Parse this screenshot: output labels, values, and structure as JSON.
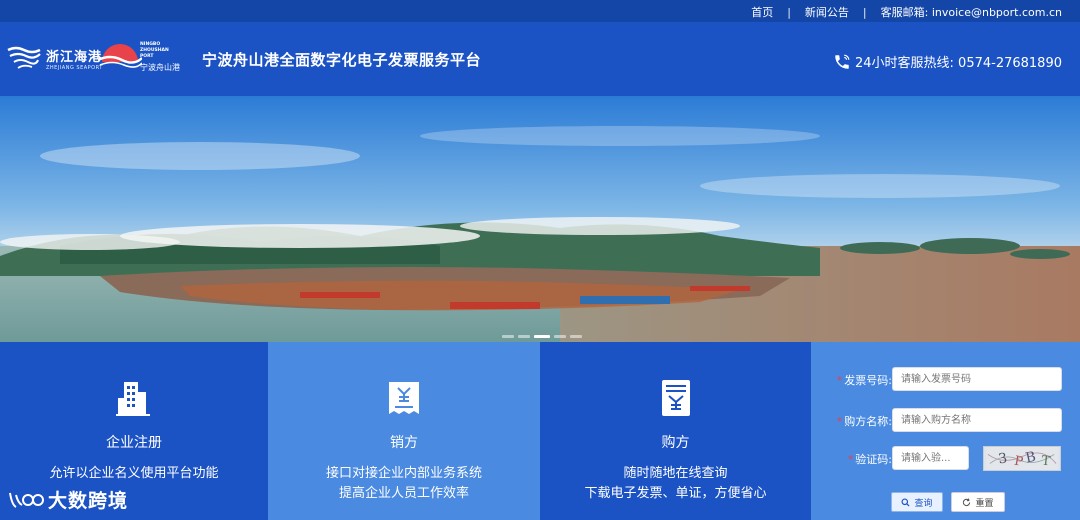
{
  "topbar": {
    "links": [
      "首页",
      "新闻公告",
      "客服邮箱: invoice@nbport.com.cn"
    ],
    "separator": "|"
  },
  "header": {
    "logo_zhejiang_cn": "浙江海港",
    "logo_zhejiang_en": "ZHEJIANG SEAPORT",
    "logo_nbzs_en": "NINGBO ZHOUSHAN PORT",
    "logo_nbzs_cn": "宁波舟山港",
    "title": "宁波舟山港全面数字化电子发票服务平台",
    "hotline": "24小时客服热线:  0574-27681890"
  },
  "banner": {
    "slides": 5,
    "active_slide": 3,
    "image_desc_icon": "port-aerial-photo"
  },
  "panels": [
    {
      "title": "企业注册",
      "desc1": "允许以企业名义使用平台功能",
      "desc2": "",
      "icon": "building-icon"
    },
    {
      "title": "销方",
      "desc1": "接口对接企业内部业务系统",
      "desc2": "提高企业人员工作效率",
      "icon": "receipt-icon"
    },
    {
      "title": "购方",
      "desc1": "随时随地在线查询",
      "desc2": "下载电子发票、单证，方便省心",
      "icon": "invoice-icon"
    }
  ],
  "query_form": {
    "invoice_no_label": "发票号码:",
    "invoice_no_placeholder": "请输入发票号码",
    "buyer_name_label": "购方名称:",
    "buyer_name_placeholder": "请输入购方名称",
    "captcha_label": "验证码:",
    "captcha_placeholder": "请输入验...",
    "query_button": "查询",
    "reset_button": "重置"
  },
  "watermark": "大数跨境",
  "colors": {
    "topbar": "#1446a8",
    "header": "#1b53c5",
    "panel_dark": "#1c53c4",
    "panel_light": "#4a8ae0"
  }
}
